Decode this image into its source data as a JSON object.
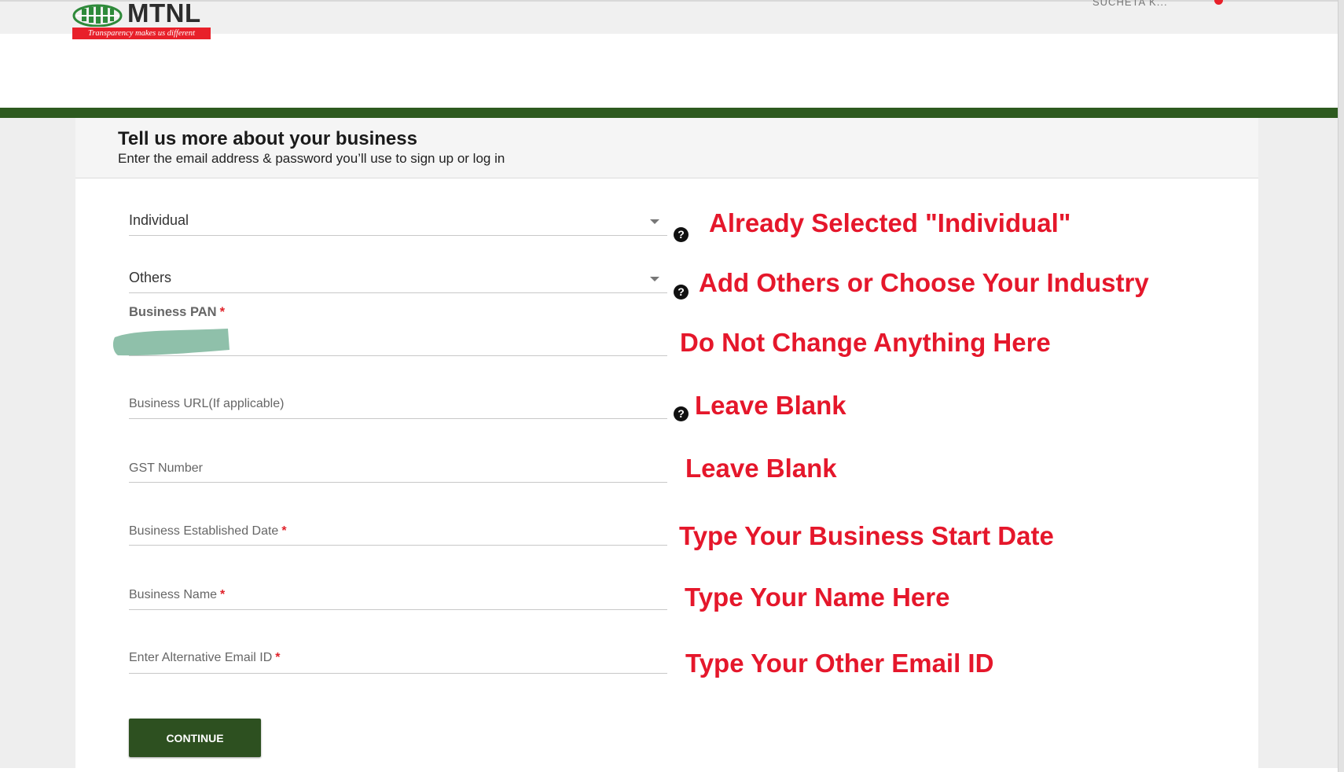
{
  "brand": {
    "name": "MTNL",
    "tagline": "Transparency makes us different",
    "red": "#e8202a"
  },
  "topbar": {
    "user_text": "SUCHETA K..."
  },
  "form": {
    "title": "Tell us more about your business",
    "subtitle": "Enter the email address & password you’ll use to sign up or log in",
    "business_type": {
      "value": "Individual"
    },
    "industry": {
      "value": "Others"
    },
    "pan": {
      "label": "Business PAN",
      "required_mark": "*"
    },
    "url": {
      "label": "Business URL(If applicable)"
    },
    "gst": {
      "label": "GST Number"
    },
    "established": {
      "label": "Business Established Date",
      "required_mark": "*"
    },
    "business_name": {
      "label": "Business Name",
      "required_mark": "*"
    },
    "alt_email": {
      "label": "Enter Alternative Email ID",
      "required_mark": "*"
    },
    "help_glyph": "?",
    "continue_label": "CONTINUE"
  },
  "annotations": {
    "business_type": "Already Selected \"Individual\"",
    "industry": "Add Others or Choose Your Industry",
    "pan": "Do Not Change Anything Here",
    "url": "Leave Blank",
    "gst": "Leave Blank",
    "established": "Type Your Business Start Date",
    "business_name": "Type Your Name Here",
    "alt_email": "Type Your Other Email ID"
  },
  "colors": {
    "accent_green": "#2d5a1f",
    "button_green": "#2d5020",
    "annotation_red": "#e5172b",
    "pan_redaction": "#8fc0aa"
  }
}
